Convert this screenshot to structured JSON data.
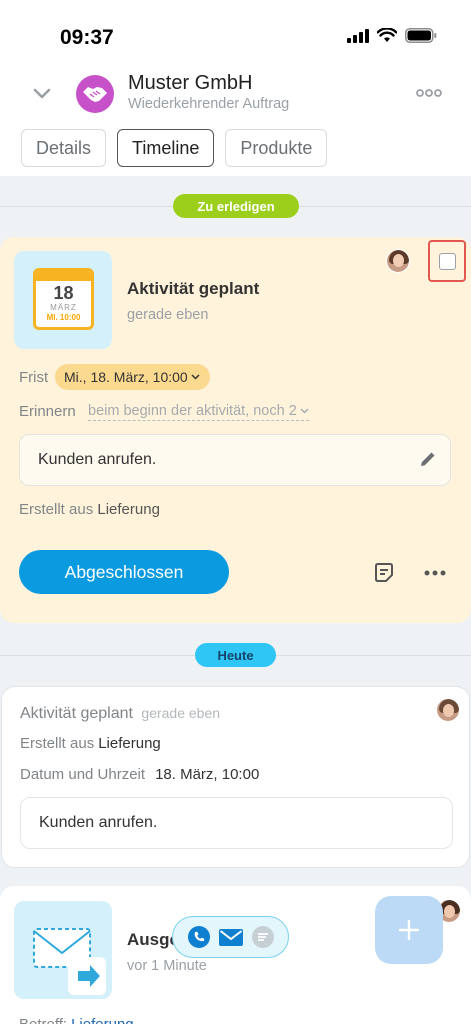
{
  "status": {
    "time": "09:37"
  },
  "header": {
    "title": "Muster GmbH",
    "subtitle": "Wiederkehrender Auftrag",
    "tabs": [
      {
        "label": "Details",
        "active": false
      },
      {
        "label": "Timeline",
        "active": true
      },
      {
        "label": "Produkte",
        "active": false
      }
    ]
  },
  "todo": {
    "section_label": "Zu erledigen",
    "calendar": {
      "day": "18",
      "month": "MÄRZ",
      "time": "MI. 10:00"
    },
    "title": "Aktivität geplant",
    "subtitle": "gerade eben",
    "deadline_label": "Frist",
    "deadline_value": "Mi., 18. März, 10:00",
    "remind_label": "Erinnern",
    "remind_value": "beim beginn der aktivität, noch 2",
    "note": "Kunden anrufen.",
    "source_label": "Erstellt aus",
    "source_value": "Lieferung",
    "done_button": "Abgeschlossen"
  },
  "today": {
    "section_label": "Heute",
    "title": "Aktivität geplant",
    "time": "gerade eben",
    "source_label": "Erstellt aus",
    "source_value": "Lieferung",
    "datetime_label": "Datum und Uhrzeit",
    "datetime_value": "18. März, 10:00",
    "note": "Kunden anrufen."
  },
  "mail": {
    "title": "Ausge",
    "subtitle": "vor 1 Minute",
    "subject_label": "Betreff:",
    "subject_value": "Lieferung"
  },
  "colors": {
    "accent": "#0a9ae0",
    "todo_bg": "#fff4db",
    "green_pill": "#9ccf1b",
    "blue_pill": "#2fc6f6",
    "logo": "#c651c9"
  },
  "icons": [
    "chevron-down-icon",
    "handshake-icon",
    "more-dots-icon",
    "pencil-icon",
    "note-icon",
    "phone-icon",
    "mail-icon",
    "chat-icon",
    "plus-icon",
    "envelope-icon"
  ]
}
